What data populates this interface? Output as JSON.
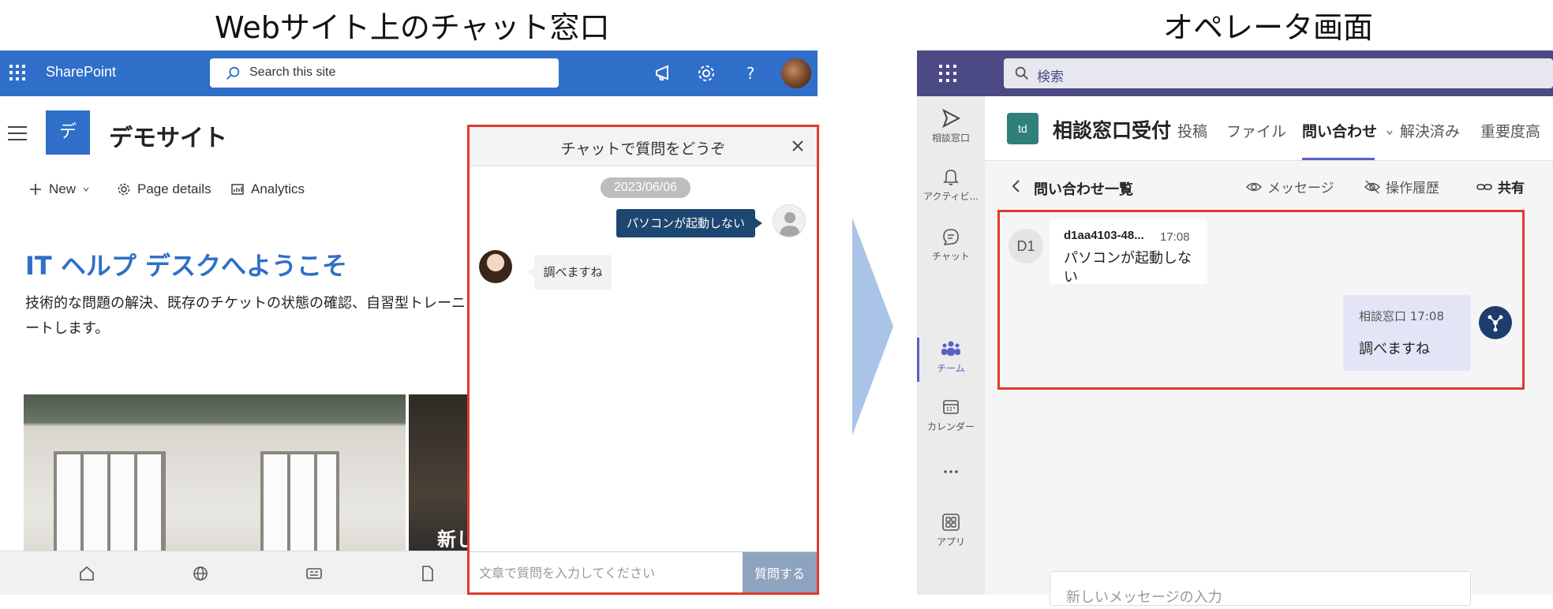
{
  "captions": {
    "left": "Webサイト上のチャット窓口",
    "right": "オペレータ画面"
  },
  "sharepoint": {
    "app_name": "SharePoint",
    "search_placeholder": "Search this site",
    "site_logo_letter": "デ",
    "site_title": "デモサイト",
    "commands": {
      "new": "New",
      "page_details": "Page details",
      "analytics": "Analytics"
    },
    "welcome_heading": "IT ヘルプ デスクへようこそ",
    "description_line1": "技術的な問題の解決、既存のチケットの状態の確認、自習型トレーニ",
    "description_line2": "ートします。",
    "image2_caption": "新し",
    "bottom_nav_icons": [
      "home-icon",
      "globe-icon",
      "news-icon",
      "document-icon"
    ]
  },
  "chat_widget": {
    "title": "チャットで質問をどうぞ",
    "date": "2023/06/06",
    "user_message": "パソコンが起動しない",
    "bot_message": "調べますね",
    "input_placeholder": "文章で質問を入力してください",
    "send_label": "質問する"
  },
  "teams": {
    "search_placeholder": "検索",
    "rail": [
      {
        "label": "相談窓口",
        "icon": "send-icon"
      },
      {
        "label": "アクティビ...",
        "icon": "bell-icon"
      },
      {
        "label": "チャット",
        "icon": "chat-icon"
      },
      {
        "label": "チーム",
        "icon": "teams-icon",
        "active": true
      },
      {
        "label": "カレンダー",
        "icon": "calendar-icon"
      },
      {
        "label": "...",
        "icon": "more-icon"
      },
      {
        "label": "アプリ",
        "icon": "apps-icon"
      }
    ],
    "team_avatar": "td",
    "team_name": "相談窓口受付",
    "tabs": [
      "投稿",
      "ファイル",
      "問い合わせ",
      "解決済み",
      "重要度高"
    ],
    "active_tab": "問い合わせ",
    "subheader": {
      "title": "問い合わせ一覧",
      "messages": "メッセージ",
      "history": "操作履歴",
      "share": "共有"
    },
    "conversation": {
      "customer_initials": "D1",
      "customer_id": "d1aa4103-48...",
      "customer_time": "17:08",
      "customer_text": "パソコンが起動しない",
      "agent_meta": "相談窓口 17:08",
      "agent_text": "調べますね"
    },
    "compose_placeholder": "新しいメッセージの入力"
  },
  "colors": {
    "sharepoint_blue": "#2f6fc9",
    "teams_purple": "#4b4a85",
    "highlight_red": "#e23a2c",
    "chat_user_bubble": "#1d4670",
    "arrow": "#a9c4e6"
  }
}
